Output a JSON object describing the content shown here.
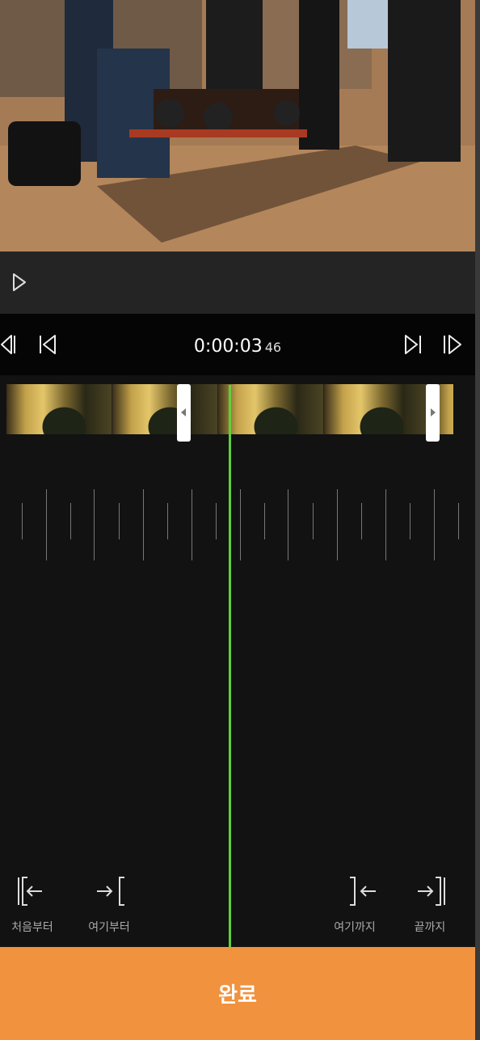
{
  "player": {
    "timecode_main": "0:00:03",
    "timecode_frames": "46"
  },
  "trim_tools": {
    "from_start_label": "처음부터",
    "from_here_label": "여기부터",
    "to_here_label": "여기까지",
    "to_end_label": "끝까지"
  },
  "done_label": "완료",
  "icons": {
    "play": "play-icon",
    "prev_frame": "prev-frame-icon",
    "skip_start": "skip-to-start-icon",
    "skip_end": "skip-to-end-icon",
    "next_frame": "next-frame-icon"
  },
  "colors": {
    "accent": "#f0923e",
    "playhead": "#5fd13c"
  }
}
